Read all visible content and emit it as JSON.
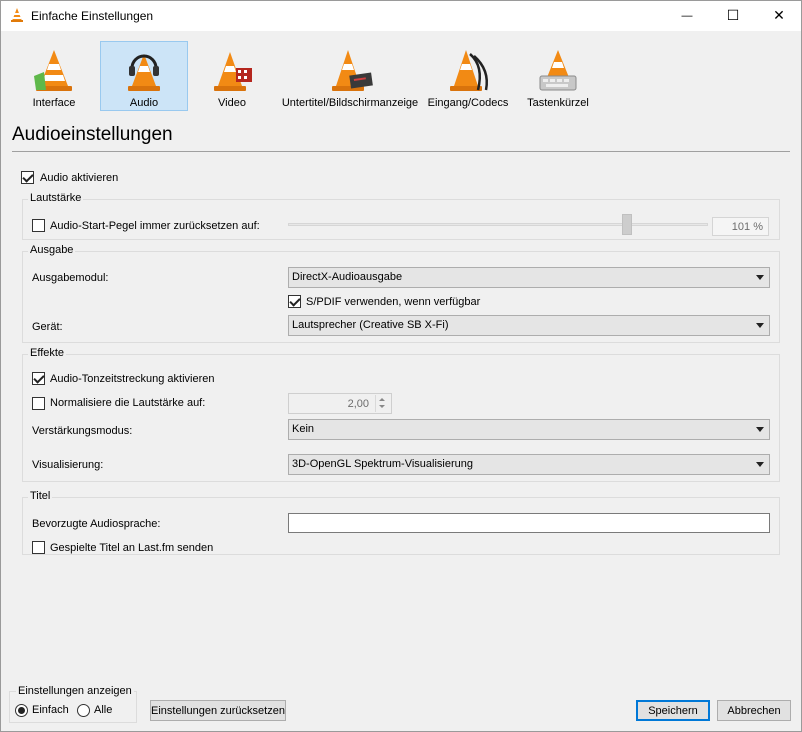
{
  "window": {
    "title": "Einfache Einstellungen",
    "minimize_glyph": "—",
    "maximize_glyph": "☐",
    "close_glyph": "✕"
  },
  "toolbar": {
    "items": [
      {
        "label": "Interface",
        "icon": "vlc-cone-interface-icon",
        "active": false
      },
      {
        "label": "Audio",
        "icon": "vlc-cone-headphones-icon",
        "active": true
      },
      {
        "label": "Video",
        "icon": "vlc-cone-film-icon",
        "active": false
      },
      {
        "label": "Untertitel/Bildschirmanzeige",
        "icon": "vlc-cone-subtitles-icon",
        "active": false
      },
      {
        "label": "Eingang/Codecs",
        "icon": "vlc-cone-cables-icon",
        "active": false
      },
      {
        "label": "Tastenkürzel",
        "icon": "vlc-cone-keyboard-icon",
        "active": false
      }
    ]
  },
  "page": {
    "title": "Audioeinstellungen"
  },
  "audio_enable": {
    "label": "Audio aktivieren",
    "checked": true
  },
  "volume": {
    "group_title": "Lautstärke",
    "reset_label": "Audio-Start-Pegel immer zurücksetzen auf:",
    "reset_checked": false,
    "value_text": "101 %",
    "level_percent": 101
  },
  "output": {
    "group_title": "Ausgabe",
    "module_label": "Ausgabemodul:",
    "module_value": "DirectX-Audioausgabe",
    "spdif_label": "S/PDIF verwenden, wenn verfügbar",
    "spdif_checked": true,
    "device_label": "Gerät:",
    "device_value": "Lautsprecher (Creative SB X-Fi)"
  },
  "effects": {
    "group_title": "Effekte",
    "timestretch_label": "Audio-Tonzeitstreckung aktivieren",
    "timestretch_checked": true,
    "normalize_label": "Normalisiere die Lautstärke auf:",
    "normalize_checked": false,
    "normalize_value": "2,00",
    "gain_label": "Verstärkungsmodus:",
    "gain_value": "Kein",
    "visual_label": "Visualisierung:",
    "visual_value": "3D-OpenGL Spektrum-Visualisierung"
  },
  "tracks": {
    "group_title": "Titel",
    "language_label": "Bevorzugte Audiosprache:",
    "language_value": "",
    "lastfm_label": "Gespielte Titel an Last.fm senden",
    "lastfm_checked": false
  },
  "show_settings": {
    "group_title": "Einstellungen anzeigen",
    "simple_label": "Einfach",
    "all_label": "Alle",
    "selected": "Einfach"
  },
  "buttons": {
    "reset": "Einstellungen zurücksetzen",
    "save": "Speichern",
    "cancel": "Abbrechen"
  },
  "colors": {
    "active_tab_bg": "#cce4f7",
    "active_tab_border": "#99c9ef",
    "default_button_border": "#0078d7",
    "vlc_orange": "#f28a14"
  }
}
